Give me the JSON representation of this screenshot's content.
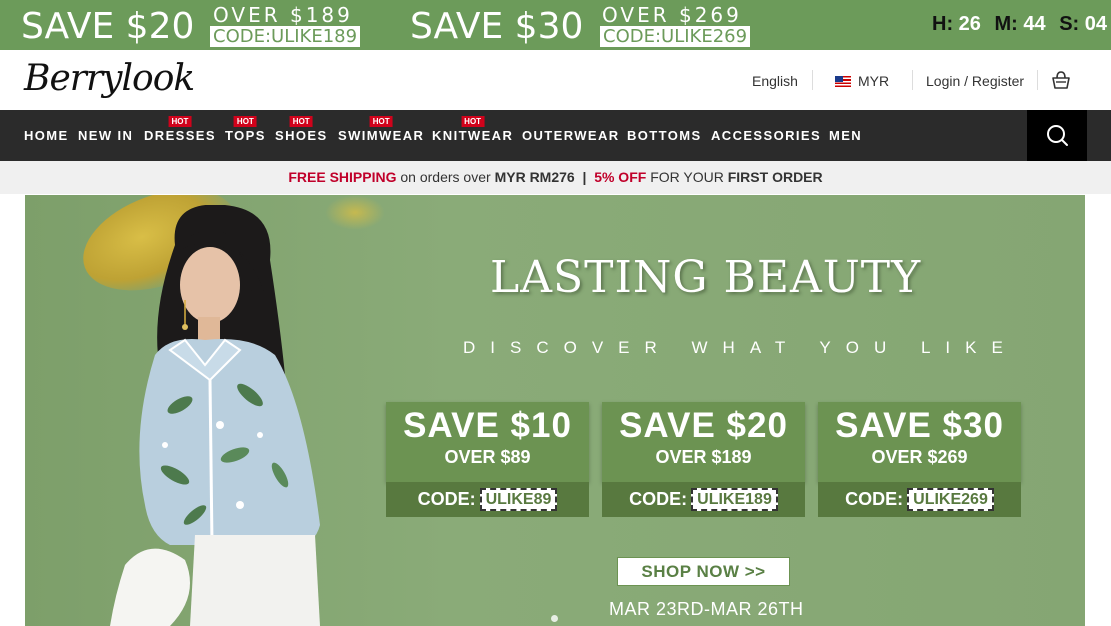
{
  "topbar": {
    "offer1": {
      "save": "SAVE $20",
      "over": "OVER $189",
      "code": "CODE:ULIKE189"
    },
    "offer2": {
      "save": "SAVE $30",
      "over": "OVER $269",
      "code": "CODE:ULIKE269"
    },
    "timer": {
      "h_label": "H:",
      "h_value": "26",
      "m_label": "M:",
      "m_value": "44",
      "s_label": "S:",
      "s_value": "04"
    }
  },
  "header": {
    "logo": "Berrylook",
    "language": "English",
    "currency": "MYR",
    "login": "Login / Register"
  },
  "nav": {
    "items": [
      {
        "label": "HOME",
        "hot": false
      },
      {
        "label": "NEW IN",
        "hot": false
      },
      {
        "label": "DRESSES",
        "hot": true
      },
      {
        "label": "TOPS",
        "hot": true
      },
      {
        "label": "SHOES",
        "hot": true
      },
      {
        "label": "SWIMWEAR",
        "hot": true
      },
      {
        "label": "KNITWEAR",
        "hot": true
      },
      {
        "label": "OUTERWEAR",
        "hot": false
      },
      {
        "label": "BOTTOMS",
        "hot": false
      },
      {
        "label": "ACCESSORIES",
        "hot": false
      },
      {
        "label": "MEN",
        "hot": false
      }
    ],
    "hot_label": "HOT"
  },
  "strip": {
    "free_shipping": "FREE SHIPPING",
    "orders_over": "on orders over",
    "threshold": "MYR RM276",
    "separator": "|",
    "discount": "5% OFF",
    "for_your": "FOR YOUR",
    "first_order": "FIRST ORDER"
  },
  "hero": {
    "title": "LASTING BEAUTY",
    "subtitle": "DISCOVER WHAT YOU LIKE",
    "coupons": [
      {
        "amount": "SAVE $10",
        "over": "OVER $89",
        "code_label": "CODE:",
        "code": "ULIKE89"
      },
      {
        "amount": "SAVE $20",
        "over": "OVER $189",
        "code_label": "CODE:",
        "code": "ULIKE189"
      },
      {
        "amount": "SAVE $30",
        "over": "OVER $269",
        "code_label": "CODE:",
        "code": "ULIKE269"
      }
    ],
    "shop_now": "SHOP NOW >>",
    "dates": "MAR 23RD-MAR 26TH"
  },
  "colors": {
    "brand_green": "#6c9b5a",
    "nav_bg": "#2b2b2b",
    "hot_red": "#d0021b",
    "accent_red": "#c0002a"
  }
}
